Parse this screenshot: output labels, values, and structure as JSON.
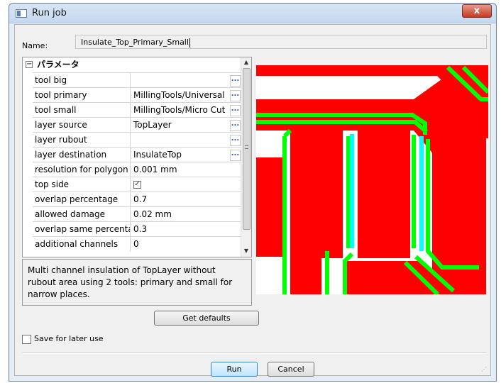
{
  "window": {
    "title": "Run job",
    "close_label": "x"
  },
  "name": {
    "label": "Name:",
    "value": "Insulate_Top_Primary_Small"
  },
  "properties": {
    "category": "パラメータ",
    "collapse_symbol": "−",
    "rows": [
      {
        "key": "tool big",
        "value": "",
        "has_button": true
      },
      {
        "key": "tool primary",
        "value": "MillingTools/Universal",
        "has_button": true
      },
      {
        "key": "tool small",
        "value": "MillingTools/Micro Cut",
        "has_button": true
      },
      {
        "key": "layer source",
        "value": "TopLayer",
        "has_button": true
      },
      {
        "key": "layer rubout",
        "value": "",
        "has_button": true
      },
      {
        "key": "layer destination",
        "value": "InsulateTop",
        "has_button": true
      },
      {
        "key": "resolution for polygon pa",
        "value": "0.001 mm",
        "has_button": false
      },
      {
        "key": "top side",
        "value": "",
        "checkbox": true,
        "checked": true
      },
      {
        "key": "overlap percentage",
        "value": "0.7",
        "has_button": false
      },
      {
        "key": "allowed damage",
        "value": "0.02 mm",
        "has_button": false
      },
      {
        "key": "overlap same percentage",
        "value": "0.3",
        "has_button": false
      },
      {
        "key": "additional channels",
        "value": "0",
        "has_button": false
      }
    ],
    "button_glyph": "...",
    "check_glyph": "✓"
  },
  "description": "Multi channel insulation of TopLayer without rubout area using 2 tools: primary and small for narrow places.",
  "buttons": {
    "get_defaults": "Get defaults",
    "run": "Run",
    "cancel": "Cancel"
  },
  "save": {
    "label": "Save for later use",
    "checked": false
  },
  "preview": {
    "background": "#ffffff",
    "copper_color": "#ff0000",
    "primary_path_color": "#00ff00",
    "small_path_color": "#00ffff"
  }
}
